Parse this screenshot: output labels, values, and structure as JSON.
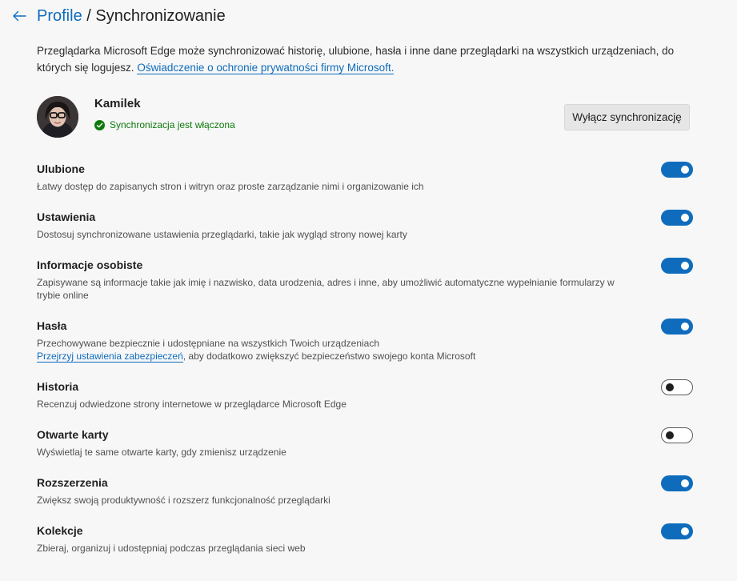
{
  "header": {
    "back_icon": "back-arrow-icon",
    "breadcrumb_parent": "Profile",
    "breadcrumb_separator": "/",
    "title": "Synchronizowanie"
  },
  "intro": {
    "text": "Przeglądarka Microsoft Edge może synchronizować historię, ulubione, hasła i inne dane przeglądarki na wszystkich urządzeniach, do których się logujesz.",
    "privacy_link": "Oświadczenie o ochronie prywatności firmy Microsoft."
  },
  "account": {
    "name": "Kamilek",
    "status": "Synchronizacja jest włączona",
    "status_icon": "check-circle-icon",
    "turn_off_button": "Wyłącz synchronizację",
    "status_color": "#0e7a0d"
  },
  "colors": {
    "accent": "#0f6cbd",
    "background": "#f7f7f7"
  },
  "settings": [
    {
      "title": "Ulubione",
      "description": "Łatwy dostęp do zapisanych stron i witryn oraz proste zarządzanie nimi i organizowanie ich",
      "enabled": true
    },
    {
      "title": "Ustawienia",
      "description": "Dostosuj synchronizowane ustawienia przeglądarki, takie jak wygląd strony nowej karty",
      "enabled": true
    },
    {
      "title": "Informacje osobiste",
      "description": "Zapisywane są informacje takie jak imię i nazwisko, data urodzenia, adres i inne, aby umożliwić automatyczne wypełnianie formularzy w trybie online",
      "enabled": true
    },
    {
      "title": "Hasła",
      "description": "Przechowywane bezpiecznie i udostępniane na wszystkich Twoich urządzeniach",
      "link": "Przejrzyj ustawienia zabezpieczeń",
      "link_suffix": ", aby dodatkowo zwiększyć bezpieczeństwo swojego konta Microsoft",
      "enabled": true
    },
    {
      "title": "Historia",
      "description": "Recenzuj odwiedzone strony internetowe w przeglądarce Microsoft Edge",
      "enabled": false
    },
    {
      "title": "Otwarte karty",
      "description": "Wyświetlaj te same otwarte karty, gdy zmienisz urządzenie",
      "enabled": false
    },
    {
      "title": "Rozszerzenia",
      "description": "Zwiększ swoją produktywność i rozszerz funkcjonalność przeglądarki",
      "enabled": true
    },
    {
      "title": "Kolekcje",
      "description": "Zbieraj, organizuj i udostępniaj podczas przeglądania sieci web",
      "enabled": true
    }
  ]
}
